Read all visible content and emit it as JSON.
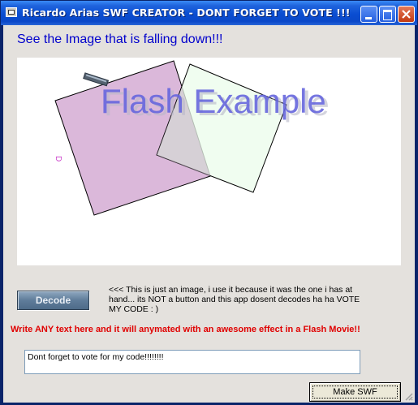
{
  "window": {
    "title": "Ricardo Arias SWF CREATOR - DONT FORGET TO VOTE !!!",
    "title_bar_color": "#0a4dd1"
  },
  "header": {
    "headline": "See the Image that is falling down!!!"
  },
  "preview": {
    "flash_text": "Flash Example",
    "small_letter": "D",
    "flash_text_color": "#6666dd",
    "square_left_color": "#dbb8da",
    "square_right_color": "#ebfceb"
  },
  "decode": {
    "label": "Decode",
    "note": "<<< This is just an image, i use it because it was the one i has at hand... its NOT a button and this app dosent decodes ha ha VOTE MY CODE : )"
  },
  "instructions": {
    "text": "Write ANY text here and it will anymated with an awesome effect in a Flash Movie!!",
    "color": "#e00000"
  },
  "input": {
    "value": "Dont forget to vote for my code!!!!!!!!"
  },
  "actions": {
    "make_label": "Make SWF"
  }
}
